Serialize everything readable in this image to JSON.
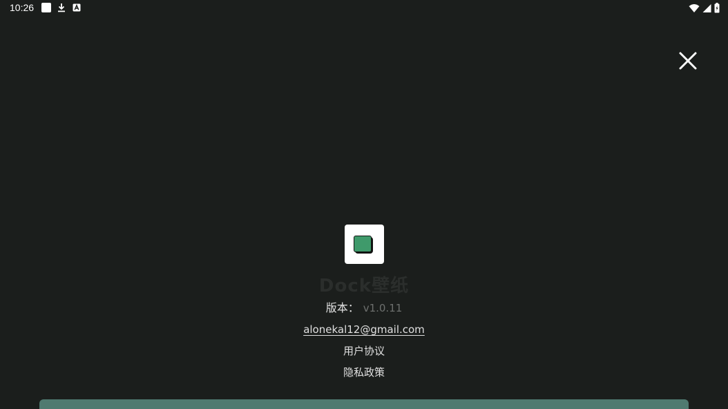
{
  "status_bar": {
    "time": "10:26",
    "left_icons": [
      "notification-square-icon",
      "download-icon",
      "app-a-icon"
    ],
    "right_icons": [
      "wifi-icon",
      "signal-icon",
      "battery-icon"
    ]
  },
  "close_icon": "close-icon",
  "app": {
    "name": "Dock壁纸",
    "version_label": "版本：",
    "version_value": "v1.0.11",
    "email": "alonekal12@gmail.com",
    "user_agreement": "用户协议",
    "privacy_policy": "隐私政策"
  },
  "colors": {
    "background": "#1b1e1c",
    "logo_green": "#3f9a6b",
    "bottom_bar": "#4f7a70"
  }
}
